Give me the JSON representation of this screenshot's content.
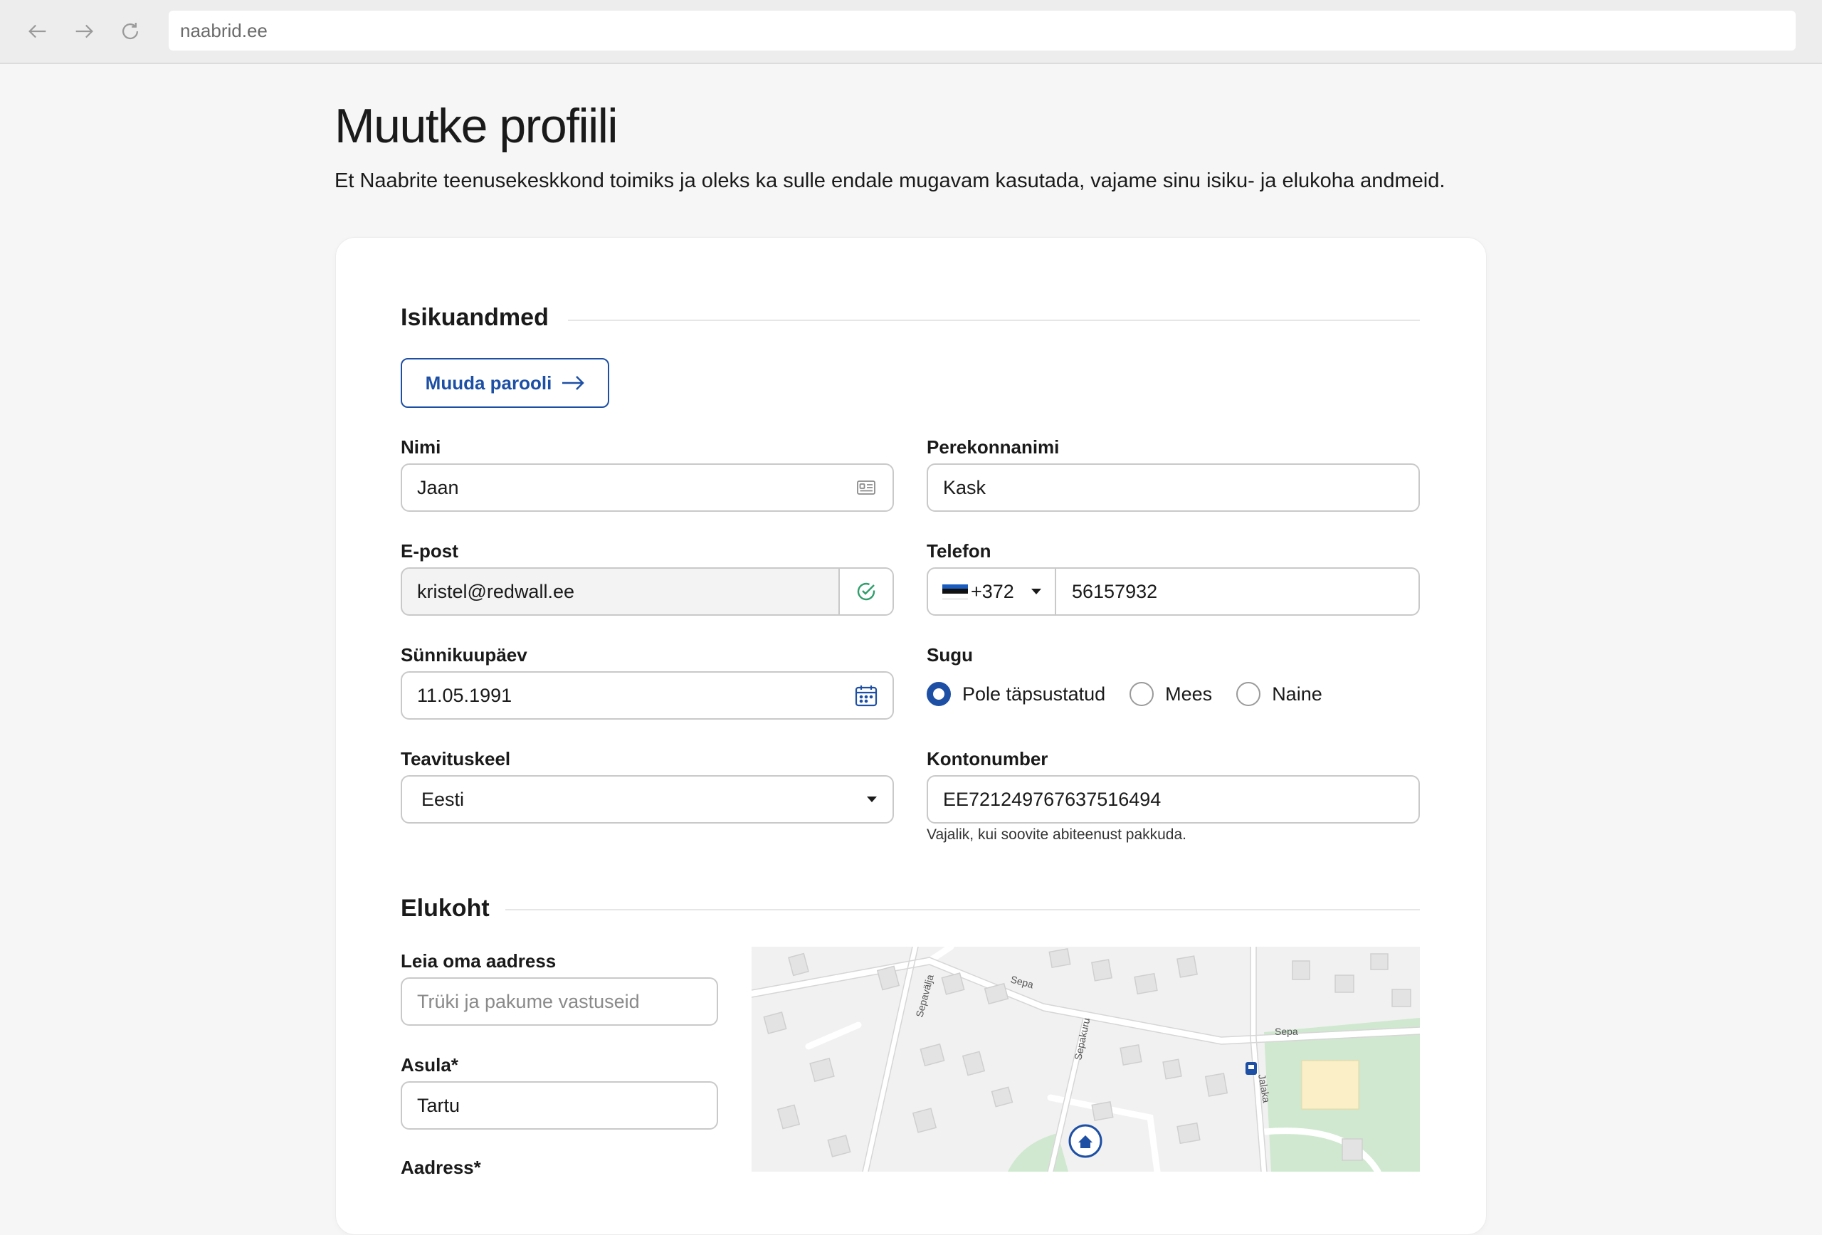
{
  "browser": {
    "url": "naabrid.ee"
  },
  "page": {
    "title": "Muutke profiili",
    "intro": "Et Naabrite teenusekeskkond toimiks ja oleks ka sulle endale mugavam kasutada, vajame sinu isiku- ja elukoha andmeid."
  },
  "personal": {
    "section_title": "Isikuandmed",
    "change_password_label": "Muuda parooli",
    "first_name": {
      "label": "Nimi",
      "value": "Jaan",
      "icon": "contact-card-icon"
    },
    "last_name": {
      "label": "Perekonnanimi",
      "value": "Kask"
    },
    "email": {
      "label": "E-post",
      "value": "kristel@redwall.ee",
      "icon": "check-circle-icon",
      "verified_color": "#2e9e6b"
    },
    "phone": {
      "label": "Telefon",
      "country_code": "+372",
      "number": "56157932",
      "flag": "estonia-flag"
    },
    "birthdate": {
      "label": "Sünnikuupäev",
      "value": "11.05.1991",
      "icon": "calendar-icon"
    },
    "gender": {
      "label": "Sugu",
      "options": [
        "Pole täpsustatud",
        "Mees",
        "Naine"
      ],
      "selected": "Pole täpsustatud"
    },
    "language": {
      "label": "Teavituskeel",
      "value": "Eesti"
    },
    "account": {
      "label": "Kontonumber",
      "value": "EE721249767637516494",
      "hint": "Vajalik, kui soovite abiteenust pakkuda."
    }
  },
  "residence": {
    "section_title": "Elukoht",
    "search": {
      "label": "Leia oma aadress",
      "placeholder": "Trüki ja pakume vastuseid"
    },
    "settlement": {
      "label": "Asula*",
      "value": "Tartu"
    },
    "address": {
      "label": "Aadress*"
    },
    "map": {
      "street_labels": [
        "Sepa",
        "Sepavälja",
        "Sepakuru",
        "Sepa",
        "Jalaka"
      ],
      "marker_icon": "home-icon",
      "bus_stop_icon": "bus-stop-icon"
    }
  },
  "colors": {
    "accent": "#1d4fa5",
    "border": "#c9c9c9",
    "success": "#2e9e6b"
  }
}
